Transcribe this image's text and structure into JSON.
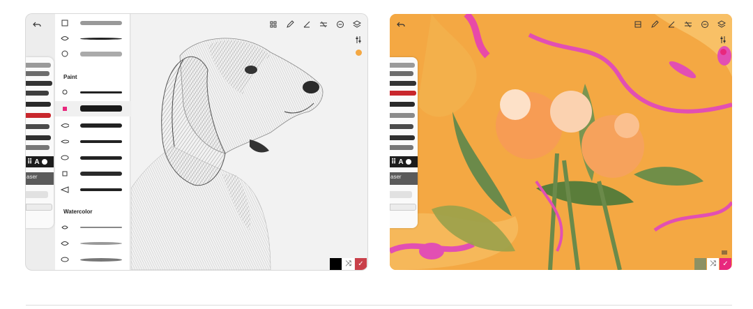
{
  "left_app": {
    "brush_panel": {
      "sections": [
        {
          "title": ""
        },
        {
          "title": "Paint"
        },
        {
          "title": "Watercolor"
        }
      ]
    },
    "tool_rail": {
      "swatch_letter": "A",
      "eraser_label": "aser"
    },
    "toolbar": {
      "icons": [
        "grid-icon",
        "pen-icon",
        "ruler-icon",
        "adjust-icon",
        "minus-circle-icon",
        "layers-icon"
      ]
    },
    "accent": "#f4a843",
    "current_color": "#000000",
    "confirm_color": "#c9404a"
  },
  "right_app": {
    "tool_rail": {
      "swatch_letter": "A",
      "eraser_label": "aser"
    },
    "current_color": "#8d9163",
    "confirm_color": "#e8287d"
  },
  "icons": {
    "shuffle": "⤨",
    "check": "✓"
  }
}
